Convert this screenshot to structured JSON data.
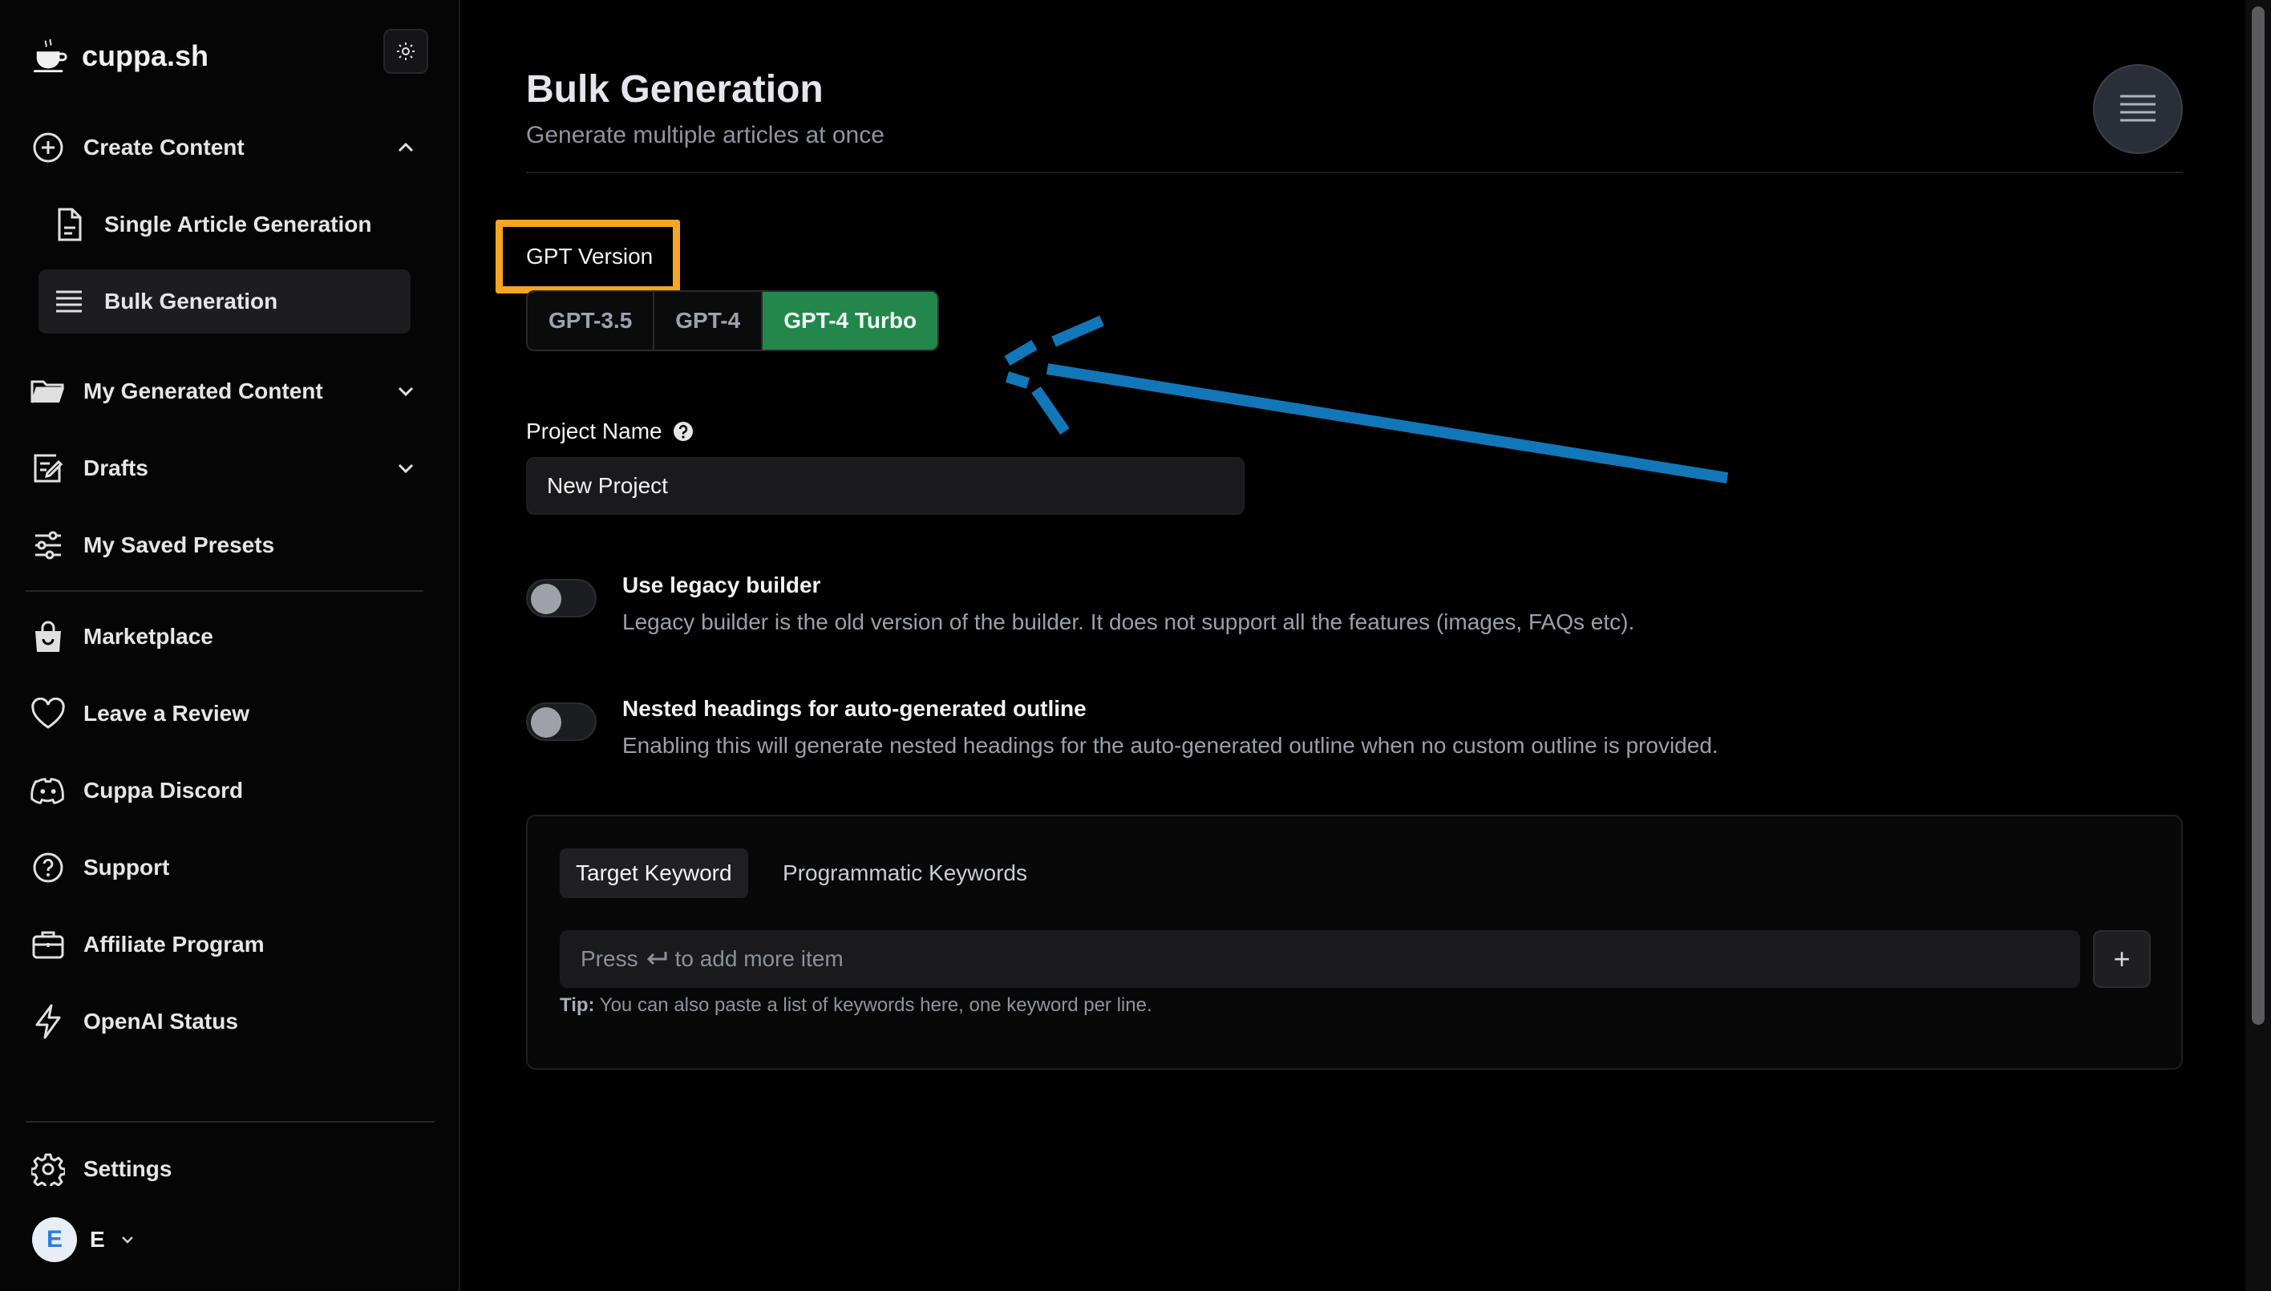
{
  "brand": {
    "name": "cuppa.sh"
  },
  "sidebar": {
    "create_content": "Create Content",
    "sub_items": [
      {
        "label": "Single Article Generation"
      },
      {
        "label": "Bulk Generation"
      }
    ],
    "items": [
      {
        "label": "My Generated Content",
        "icon": "folder-icon"
      },
      {
        "label": "Drafts",
        "icon": "edit-icon"
      },
      {
        "label": "My Saved Presets",
        "icon": "sliders-icon"
      },
      {
        "label": "Marketplace",
        "icon": "shopping-bag-icon"
      },
      {
        "label": "Leave a Review",
        "icon": "heart-icon"
      },
      {
        "label": "Cuppa Discord",
        "icon": "discord-icon"
      },
      {
        "label": "Support",
        "icon": "help-circle-icon"
      },
      {
        "label": "Affiliate Program",
        "icon": "briefcase-icon"
      },
      {
        "label": "OpenAI Status",
        "icon": "bolt-icon"
      }
    ],
    "settings": "Settings",
    "user": {
      "avatar": "E",
      "name": "E"
    }
  },
  "page": {
    "title": "Bulk Generation",
    "subtitle": "Generate multiple articles at once"
  },
  "gpt": {
    "label": "GPT Version",
    "options": [
      "GPT-3.5",
      "GPT-4",
      "GPT-4 Turbo"
    ],
    "selected": "GPT-4 Turbo"
  },
  "project": {
    "label": "Project Name",
    "value": "New Project"
  },
  "toggles": [
    {
      "title": "Use legacy builder",
      "desc": "Legacy builder is the old version of the builder. It does not support all the features (images, FAQs etc).",
      "on": false
    },
    {
      "title": "Nested headings for auto-generated outline",
      "desc": "Enabling this will generate nested headings for the auto-generated outline when no custom outline is provided.",
      "on": false
    }
  ],
  "keywords": {
    "tabs": [
      "Target Keyword",
      "Programmatic Keywords"
    ],
    "active_tab": "Target Keyword",
    "placeholder_before": "Press",
    "placeholder_after": "to add more item",
    "add_label": "+",
    "tip_label": "Tip:",
    "tip_text": "You can also paste a list of keywords here, one keyword per line."
  },
  "colors": {
    "accent_green": "#23874c",
    "highlight_orange": "#f5a623",
    "annotation_blue": "#1277b8"
  }
}
